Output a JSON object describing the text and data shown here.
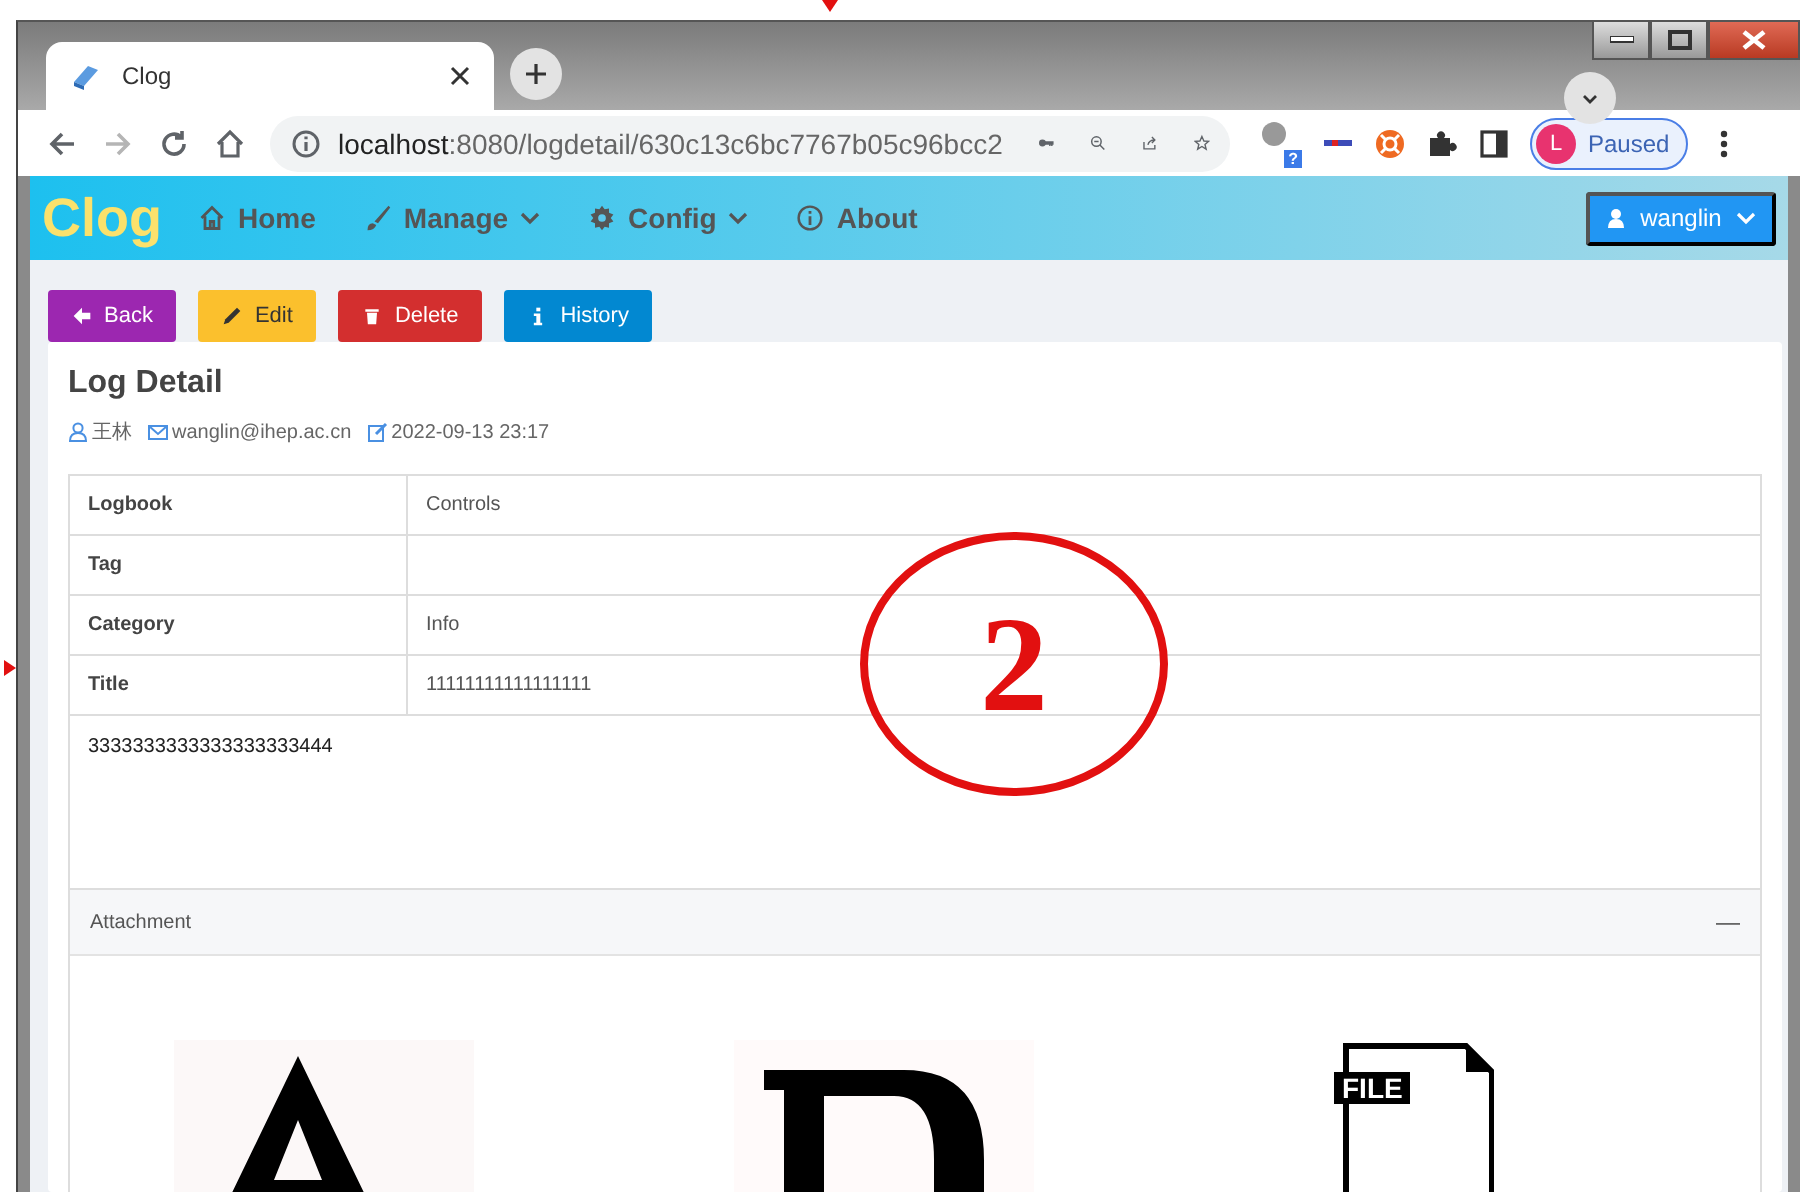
{
  "browser": {
    "tab_title": "Clog",
    "address_host": "localhost",
    "address_path": ":8080/logdetail/630c13c6bc7767b05c96bcc2",
    "extension_badge": "?",
    "profile_initial": "L",
    "profile_status": "Paused"
  },
  "navbar": {
    "brand": "Clog",
    "items": [
      {
        "label": "Home",
        "dropdown": false
      },
      {
        "label": "Manage",
        "dropdown": true
      },
      {
        "label": "Config",
        "dropdown": true
      },
      {
        "label": "About",
        "dropdown": false
      }
    ],
    "user": "wanglin"
  },
  "actions": [
    {
      "label": "Back",
      "kind": "back",
      "color": "#9c27b0"
    },
    {
      "label": "Edit",
      "kind": "edit",
      "color": "#fbc02d"
    },
    {
      "label": "Delete",
      "kind": "delete",
      "color": "#d32f2f"
    },
    {
      "label": "History",
      "kind": "history",
      "color": "#0288d1"
    }
  ],
  "log": {
    "title": "Log Detail",
    "author": "王林",
    "email": "wanglin@ihep.ac.cn",
    "date": "2022-09-13 23:17",
    "fields": [
      {
        "label": "Logbook",
        "value": "Controls"
      },
      {
        "label": "Tag"
      },
      {
        "label": "Category",
        "value": "Info"
      },
      {
        "label": "Title",
        "value": "11111111111111111"
      }
    ],
    "content": "3333333333333333333444"
  },
  "attachments": {
    "title": "Attachment",
    "collapse_symbol": "—",
    "items": [
      {
        "kind": "picture"
      },
      {
        "kind": "picture"
      },
      {
        "kind": "file",
        "label": "FILE"
      }
    ]
  },
  "annotation": {
    "label": "2"
  }
}
